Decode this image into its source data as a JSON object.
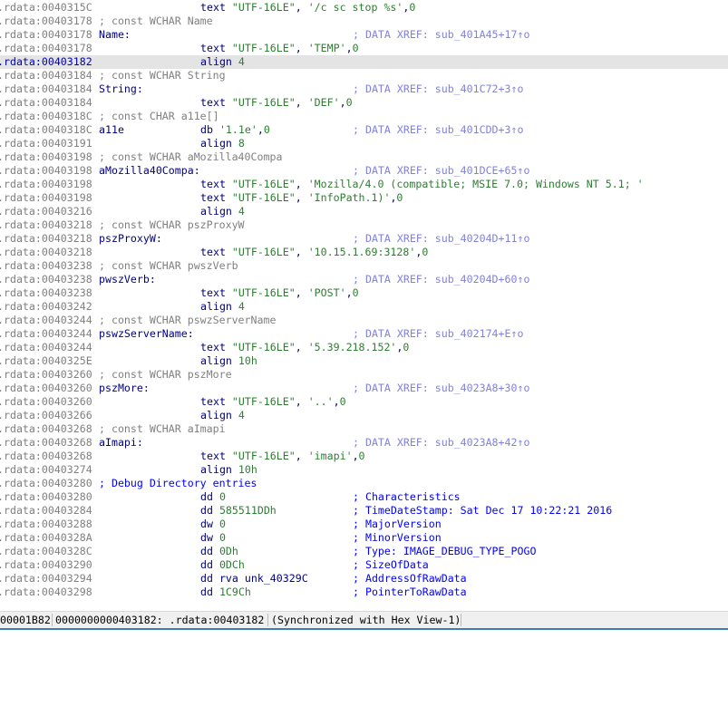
{
  "colors": {
    "address": "#7f7f7f",
    "selected_address": "#0000b0",
    "mnemonic": "#000080",
    "string": "#2e7d32",
    "comment": "#808080",
    "xref": "#8080e0",
    "auto_comment": "#0000ff",
    "selection_bg": "#e4e4e4"
  },
  "selected_line": 4,
  "lines": [
    {
      "addr": ".rdata:0040315C",
      "op": "text",
      "args": [
        [
          "\"UTF-16LE\"",
          "str"
        ],
        [
          ", ",
          "pun"
        ],
        [
          "'/c sc stop %s'",
          "str"
        ],
        [
          ",",
          "pun"
        ],
        [
          "0",
          "num"
        ]
      ]
    },
    {
      "addr": ".rdata:00403178",
      "line_cmt": "; const WCHAR Name"
    },
    {
      "addr": ".rdata:00403178",
      "label": "Name:",
      "cmt": "; DATA XREF: sub_401A45+17↑o"
    },
    {
      "addr": ".rdata:00403178",
      "op": "text",
      "args": [
        [
          "\"UTF-16LE\"",
          "str"
        ],
        [
          ", ",
          "pun"
        ],
        [
          "'TEMP'",
          "str"
        ],
        [
          ",",
          "pun"
        ],
        [
          "0",
          "num"
        ]
      ]
    },
    {
      "addr": ".rdata:00403182",
      "op": "align",
      "args": [
        [
          "4",
          "num"
        ]
      ]
    },
    {
      "addr": ".rdata:00403184",
      "line_cmt": "; const WCHAR String"
    },
    {
      "addr": ".rdata:00403184",
      "label": "String:",
      "cmt": "; DATA XREF: sub_401C72+3↑o"
    },
    {
      "addr": ".rdata:00403184",
      "op": "text",
      "args": [
        [
          "\"UTF-16LE\"",
          "str"
        ],
        [
          ", ",
          "pun"
        ],
        [
          "'DEF'",
          "str"
        ],
        [
          ",",
          "pun"
        ],
        [
          "0",
          "num"
        ]
      ]
    },
    {
      "addr": ".rdata:0040318C",
      "line_cmt": "; const CHAR a11e[]"
    },
    {
      "addr": ".rdata:0040318C",
      "label": "a11e",
      "op": "db",
      "args": [
        [
          "'1.1e'",
          "str"
        ],
        [
          ",",
          "pun"
        ],
        [
          "0",
          "num"
        ]
      ],
      "cmt": "; DATA XREF: sub_401CDD+3↑o"
    },
    {
      "addr": ".rdata:00403191",
      "op": "align",
      "args": [
        [
          "8",
          "num"
        ]
      ]
    },
    {
      "addr": ".rdata:00403198",
      "line_cmt": "; const WCHAR aMozilla40Compa"
    },
    {
      "addr": ".rdata:00403198",
      "label": "aMozilla40Compa:",
      "cmt": "; DATA XREF: sub_401DCE+65↑o"
    },
    {
      "addr": ".rdata:00403198",
      "op": "text",
      "args": [
        [
          "\"UTF-16LE\"",
          "str"
        ],
        [
          ", ",
          "pun"
        ],
        [
          "'Mozilla/4.0 (compatible; MSIE 7.0; Windows NT 5.1; '",
          "str"
        ]
      ]
    },
    {
      "addr": ".rdata:00403198",
      "op": "text",
      "args": [
        [
          "\"UTF-16LE\"",
          "str"
        ],
        [
          ", ",
          "pun"
        ],
        [
          "'InfoPath.1)'",
          "str"
        ],
        [
          ",",
          "pun"
        ],
        [
          "0",
          "num"
        ]
      ]
    },
    {
      "addr": ".rdata:00403216",
      "op": "align",
      "args": [
        [
          "4",
          "num"
        ]
      ]
    },
    {
      "addr": ".rdata:00403218",
      "line_cmt": "; const WCHAR pszProxyW"
    },
    {
      "addr": ".rdata:00403218",
      "label": "pszProxyW:",
      "cmt": "; DATA XREF: sub_40204D+11↑o"
    },
    {
      "addr": ".rdata:00403218",
      "op": "text",
      "args": [
        [
          "\"UTF-16LE\"",
          "str"
        ],
        [
          ", ",
          "pun"
        ],
        [
          "'10.15.1.69:3128'",
          "str"
        ],
        [
          ",",
          "pun"
        ],
        [
          "0",
          "num"
        ]
      ]
    },
    {
      "addr": ".rdata:00403238",
      "line_cmt": "; const WCHAR pwszVerb"
    },
    {
      "addr": ".rdata:00403238",
      "label": "pwszVerb:",
      "cmt": "; DATA XREF: sub_40204D+60↑o"
    },
    {
      "addr": ".rdata:00403238",
      "op": "text",
      "args": [
        [
          "\"UTF-16LE\"",
          "str"
        ],
        [
          ", ",
          "pun"
        ],
        [
          "'POST'",
          "str"
        ],
        [
          ",",
          "pun"
        ],
        [
          "0",
          "num"
        ]
      ]
    },
    {
      "addr": ".rdata:00403242",
      "op": "align",
      "args": [
        [
          "4",
          "num"
        ]
      ]
    },
    {
      "addr": ".rdata:00403244",
      "line_cmt": "; const WCHAR pswzServerName"
    },
    {
      "addr": ".rdata:00403244",
      "label": "pswzServerName:",
      "cmt": "; DATA XREF: sub_402174+E↑o"
    },
    {
      "addr": ".rdata:00403244",
      "op": "text",
      "args": [
        [
          "\"UTF-16LE\"",
          "str"
        ],
        [
          ", ",
          "pun"
        ],
        [
          "'5.39.218.152'",
          "str"
        ],
        [
          ",",
          "pun"
        ],
        [
          "0",
          "num"
        ]
      ]
    },
    {
      "addr": ".rdata:0040325E",
      "op": "align",
      "args": [
        [
          "10h",
          "num"
        ]
      ]
    },
    {
      "addr": ".rdata:00403260",
      "line_cmt": "; const WCHAR pszMore"
    },
    {
      "addr": ".rdata:00403260",
      "label": "pszMore:",
      "cmt": "; DATA XREF: sub_4023A8+30↑o"
    },
    {
      "addr": ".rdata:00403260",
      "op": "text",
      "args": [
        [
          "\"UTF-16LE\"",
          "str"
        ],
        [
          ", ",
          "pun"
        ],
        [
          "'..'",
          "str"
        ],
        [
          ",",
          "pun"
        ],
        [
          "0",
          "num"
        ]
      ]
    },
    {
      "addr": ".rdata:00403266",
      "op": "align",
      "args": [
        [
          "4",
          "num"
        ]
      ]
    },
    {
      "addr": ".rdata:00403268",
      "line_cmt": "; const WCHAR aImapi"
    },
    {
      "addr": ".rdata:00403268",
      "label": "aImapi:",
      "cmt": "; DATA XREF: sub_4023A8+42↑o"
    },
    {
      "addr": ".rdata:00403268",
      "op": "text",
      "args": [
        [
          "\"UTF-16LE\"",
          "str"
        ],
        [
          ", ",
          "pun"
        ],
        [
          "'imapi'",
          "str"
        ],
        [
          ",",
          "pun"
        ],
        [
          "0",
          "num"
        ]
      ]
    },
    {
      "addr": ".rdata:00403274",
      "op": "align",
      "args": [
        [
          "10h",
          "num"
        ]
      ]
    },
    {
      "addr": ".rdata:00403280",
      "line_cmt": "; Debug Directory entries",
      "line_cmt_blue": true
    },
    {
      "addr": ".rdata:00403280",
      "op": "dd",
      "args": [
        [
          "0",
          "num"
        ]
      ],
      "cmt": "; Characteristics",
      "cmt_blue": true
    },
    {
      "addr": ".rdata:00403284",
      "op": "dd",
      "args": [
        [
          "585511DDh",
          "num"
        ]
      ],
      "cmt": "; TimeDateStamp: Sat Dec 17 10:22:21 2016",
      "cmt_blue": true
    },
    {
      "addr": ".rdata:00403288",
      "op": "dw",
      "args": [
        [
          "0",
          "num"
        ]
      ],
      "cmt": "; MajorVersion",
      "cmt_blue": true
    },
    {
      "addr": ".rdata:0040328A",
      "op": "dw",
      "args": [
        [
          "0",
          "num"
        ]
      ],
      "cmt": "; MinorVersion",
      "cmt_blue": true
    },
    {
      "addr": ".rdata:0040328C",
      "op": "dd",
      "args": [
        [
          "0Dh",
          "num"
        ]
      ],
      "cmt": "; Type: IMAGE_DEBUG_TYPE_POGO",
      "cmt_blue": true
    },
    {
      "addr": ".rdata:00403290",
      "op": "dd",
      "args": [
        [
          "0DCh",
          "num"
        ]
      ],
      "cmt": "; SizeOfData",
      "cmt_blue": true
    },
    {
      "addr": ".rdata:00403294",
      "op": "dd",
      "args": [
        [
          "rva unk_40329C",
          "pun"
        ]
      ],
      "cmt": "; AddressOfRawData",
      "cmt_blue": true
    },
    {
      "addr": ".rdata:00403298",
      "op": "dd",
      "args": [
        [
          "1C9Ch",
          "num"
        ]
      ],
      "cmt": "; PointerToRawData",
      "cmt_blue": true
    }
  ],
  "status": {
    "file_offset": "00001B82",
    "location": "0000000000403182: .rdata:00403182",
    "sync": "(Synchronized with Hex View-1)"
  }
}
